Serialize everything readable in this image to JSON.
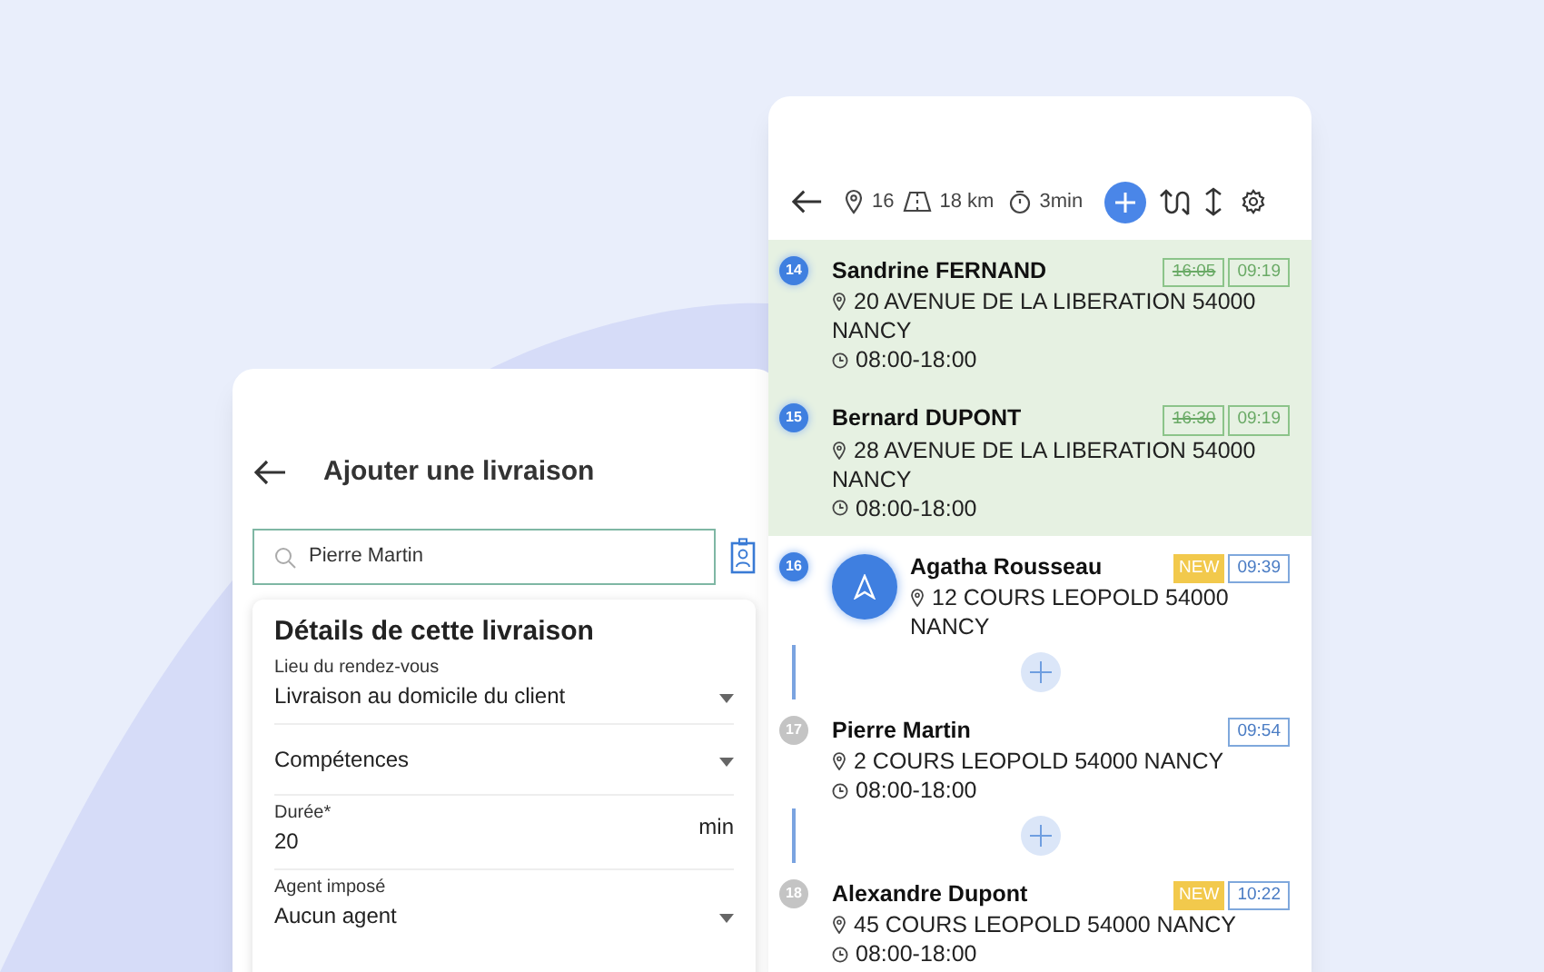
{
  "form_screen": {
    "title": "Ajouter une livraison",
    "search": {
      "value": "Pierre Martin"
    },
    "card_title": "Détails de cette livraison",
    "fields": [
      {
        "kind": "select",
        "label": "Lieu du rendez-vous",
        "value": "Livraison au domicile du client"
      },
      {
        "kind": "select",
        "value": "Compétences"
      },
      {
        "kind": "number",
        "label": "Durée*",
        "value": "20",
        "unit": "min"
      },
      {
        "kind": "select",
        "label": "Agent imposé",
        "value": "Aucun agent"
      }
    ]
  },
  "route_screen": {
    "toolbar": {
      "stops": "16",
      "distance": "18 km",
      "duration": "3min"
    },
    "stops": [
      {
        "kind": "done",
        "number": "14",
        "name": "Sandrine FERNAND",
        "address": "20 AVENUE DE LA LIBERATION 54000 NANCY",
        "hours": "08:00-18:00",
        "old_time": "16:05",
        "time": "09:19",
        "new": false
      },
      {
        "kind": "done",
        "number": "15",
        "name": "Bernard DUPONT",
        "address": "28 AVENUE DE LA LIBERATION 54000 NANCY",
        "hours": "08:00-18:00",
        "old_time": "16:30",
        "time": "09:19",
        "new": false
      },
      {
        "kind": "current",
        "number": "16",
        "name": "Agatha Rousseau",
        "address": "12 COURS LEOPOLD 54000 NANCY",
        "new_label": "NEW",
        "time": "09:39",
        "new": true
      },
      {
        "kind": "pending",
        "number": "17",
        "name": "Pierre Martin",
        "address": "2 COURS LEOPOLD 54000 NANCY",
        "hours": "08:00-18:00",
        "time": "09:54",
        "new": false
      },
      {
        "kind": "pending",
        "number": "18",
        "name": "Alexandre Dupont",
        "address": "45 COURS LEOPOLD 54000 NANCY",
        "hours": "08:00-18:00",
        "new_label": "NEW",
        "time": "10:22",
        "new": true
      }
    ]
  }
}
